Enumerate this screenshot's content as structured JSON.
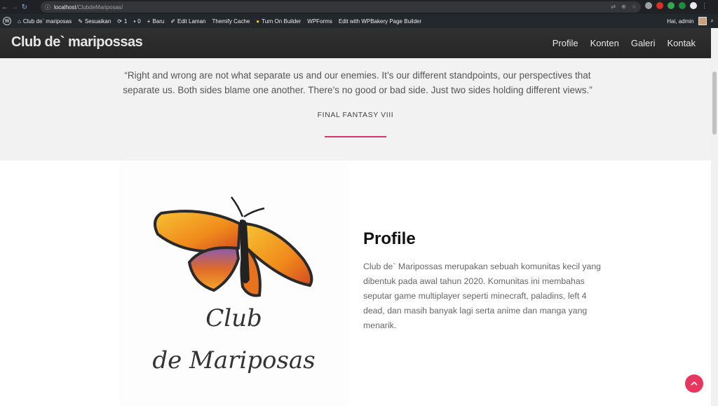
{
  "browser": {
    "url_host": "localhost",
    "url_path": "/ClubdeMariposas/"
  },
  "admin_bar": {
    "site_name": "Club de` mariposas",
    "customize": "Sesuaikan",
    "updates": "1",
    "comments": "0",
    "new": "Baru",
    "edit_page": "Edit Laman",
    "themify_cache": "Themify Cache",
    "builder": "Turn On Builder",
    "wpforms": "WPForms",
    "wpbakery": "Edit with WPBakery Page Builder",
    "greeting": "Hai, admin"
  },
  "site": {
    "title": "Club de` maripossas",
    "menu": [
      "Profile",
      "Konten",
      "Galeri",
      "Kontak"
    ]
  },
  "quote": {
    "text": "“Right and wrong are not what separate us and our enemies. It’s our different standpoints, our perspectives that separate us. Both sides blame one another. There’s no good or bad side. Just two sides holding different views.”",
    "source": "FINAL FANTASY VIII"
  },
  "logo": {
    "line1": "Club",
    "line2": "de Mariposas"
  },
  "profile": {
    "heading": "Profile",
    "body": "Club de` Maripossas merupakan sebuah komunitas kecil yang dibentuk pada awal tahun 2020. Komunitas ini membahas seputar game multiplayer seperti minecraft, paladins, left 4 dead, dan masih banyak lagi serta anime dan manga yang menarik."
  },
  "colors": {
    "accent": "#d9356d",
    "fab": "#e8375e"
  }
}
